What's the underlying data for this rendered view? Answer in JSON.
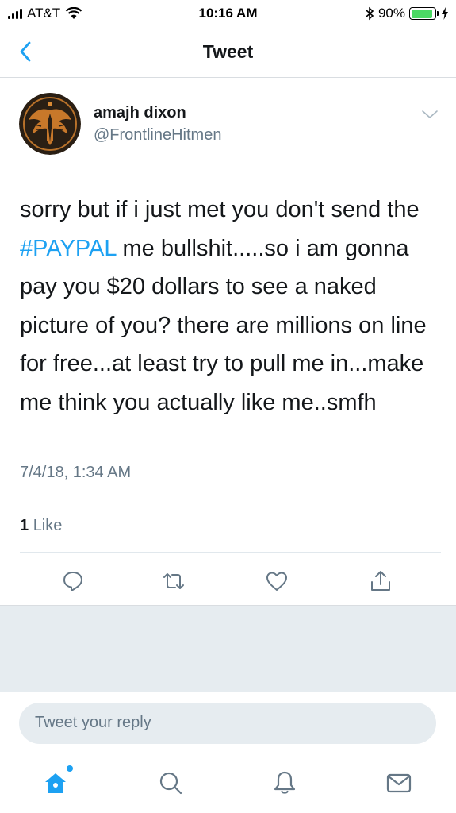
{
  "status_bar": {
    "carrier": "AT&T",
    "time": "10:16 AM",
    "battery_percent_label": "90%",
    "battery_level": 0.9
  },
  "nav": {
    "title": "Tweet",
    "back_icon": "chevron-left-icon"
  },
  "tweet": {
    "author_name": "amajh dixon",
    "author_handle": "@FrontlineHitmen",
    "text_before_hashtag": "sorry but if i just met you don't send the ",
    "hashtag": "#PAYPAL",
    "text_after_hashtag": " me bullshit.....so i am gonna pay you $20 dollars to see a naked picture of you? there are millions on line for free...at least try to pull me in...make me think you actually like me..smfh",
    "timestamp": "7/4/18, 1:34 AM",
    "like_count": "1",
    "like_label": "Like"
  },
  "actions": [
    {
      "name": "reply",
      "icon": "speech-bubble-icon"
    },
    {
      "name": "retweet",
      "icon": "retweet-icon"
    },
    {
      "name": "like",
      "icon": "heart-icon"
    },
    {
      "name": "share",
      "icon": "share-icon"
    }
  ],
  "reply": {
    "placeholder": "Tweet your reply"
  },
  "tabs": [
    {
      "name": "home",
      "icon": "home-icon",
      "active": true
    },
    {
      "name": "search",
      "icon": "search-icon",
      "active": false
    },
    {
      "name": "notifications",
      "icon": "bell-icon",
      "active": false
    },
    {
      "name": "messages",
      "icon": "envelope-icon",
      "active": false
    }
  ],
  "colors": {
    "accent": "#1da1f2",
    "secondary_text": "#657786",
    "primary_text": "#14171a",
    "divider": "#e1e8ed",
    "gray_background": "#e6ecf0",
    "battery_green": "#4cd964"
  }
}
